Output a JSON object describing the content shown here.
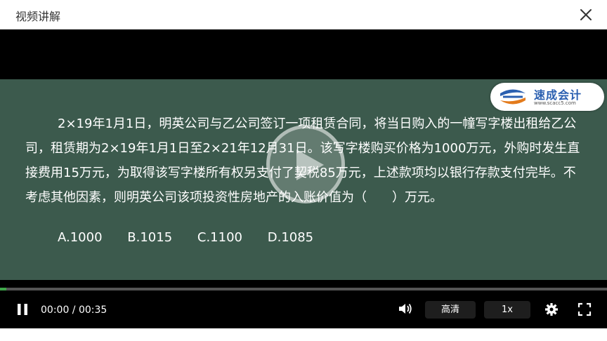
{
  "window": {
    "title": "视频讲解",
    "close_icon": "close-icon"
  },
  "logo": {
    "text": "速成会计",
    "url": "www.scacc5.com"
  },
  "question": {
    "text": "2×19年1月1日，明英公司与乙公司签订一项租赁合同，将当日购入的一幢写字楼出租给乙公司，租赁期为2×19年1月1日至2×21年12月31日。该写字楼购买价格为1000万元，外购时发生直接费用15万元，为取得该写字楼所有权另支付了契税85万元，上述款项均以银行存款支付完毕。不考虑其他因素，则明英公司该项投资性房地产的入账价值为（　　）万元。",
    "options": [
      "A.1000",
      "B.1015",
      "C.1100",
      "D.1085"
    ]
  },
  "player": {
    "time_display": "00:00 / 00:35",
    "progress": 0.01,
    "quality_label": "高清",
    "speed_label": "1x",
    "colors": {
      "progress": "#3fa74a",
      "board": "#3c5a4d"
    }
  }
}
